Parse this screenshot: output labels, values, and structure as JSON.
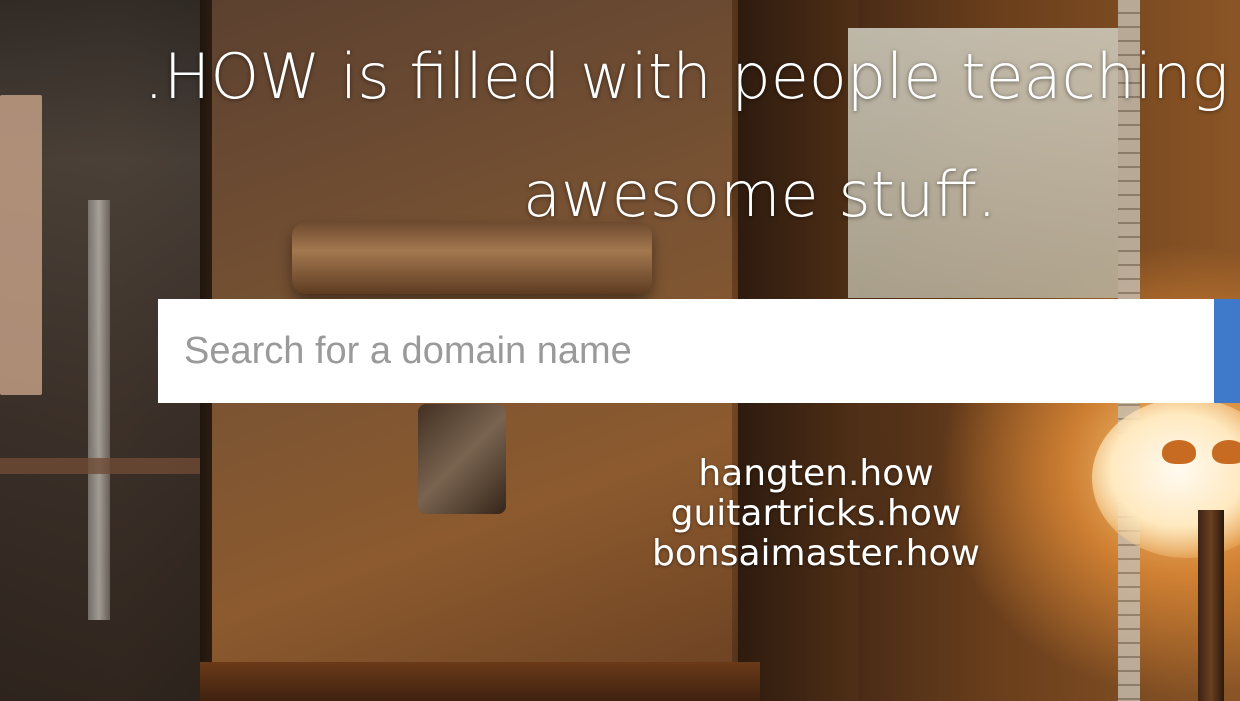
{
  "hero": {
    "headline_line1": ".HOW is filled with people teaching",
    "headline_line2": "awesome stuff."
  },
  "search": {
    "placeholder": "Search for a domain name",
    "button_color": "#3f79c9"
  },
  "examples": [
    {
      "label": "hangten.how"
    },
    {
      "label": "guitartricks.how"
    },
    {
      "label": "bonsaimaster.how"
    }
  ],
  "colors": {
    "text": "#ffffff",
    "input_bg": "#ffffff",
    "placeholder": "#9a9a9a"
  }
}
